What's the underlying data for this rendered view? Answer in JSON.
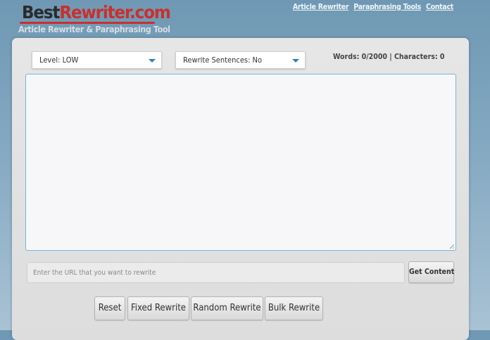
{
  "header": {
    "logo_best": "Best",
    "logo_rewriter": "Rewriter.com",
    "tagline": "Article Rewriter & Paraphrasing Tool",
    "nav": [
      {
        "label": "Article Rewriter"
      },
      {
        "label": "Paraphrasing Tools"
      },
      {
        "label": "Contact"
      }
    ]
  },
  "controls": {
    "level_label": "Level:  LOW",
    "sentences_label": "Rewrite Sentences:  No",
    "stats": "Words: 0/2000 | Characters: 0"
  },
  "editor": {
    "value": ""
  },
  "url": {
    "placeholder": "Enter the URL that you want to rewrite",
    "value": "",
    "get_content_label": "Get Content"
  },
  "actions": {
    "reset_label": "Reset",
    "fixed_label": "Fixed Rewrite",
    "random_label": "Random Rewrite",
    "bulk_label": "Bulk Rewrite"
  },
  "colors": {
    "brand_red": "#c9302c",
    "caret_blue": "#2c7fc2",
    "textarea_border": "#79b4db"
  },
  "icons": {
    "level_caret": "chevron-down-icon",
    "sentences_caret": "chevron-down-icon",
    "textarea_resize": "resize-grip-icon"
  }
}
